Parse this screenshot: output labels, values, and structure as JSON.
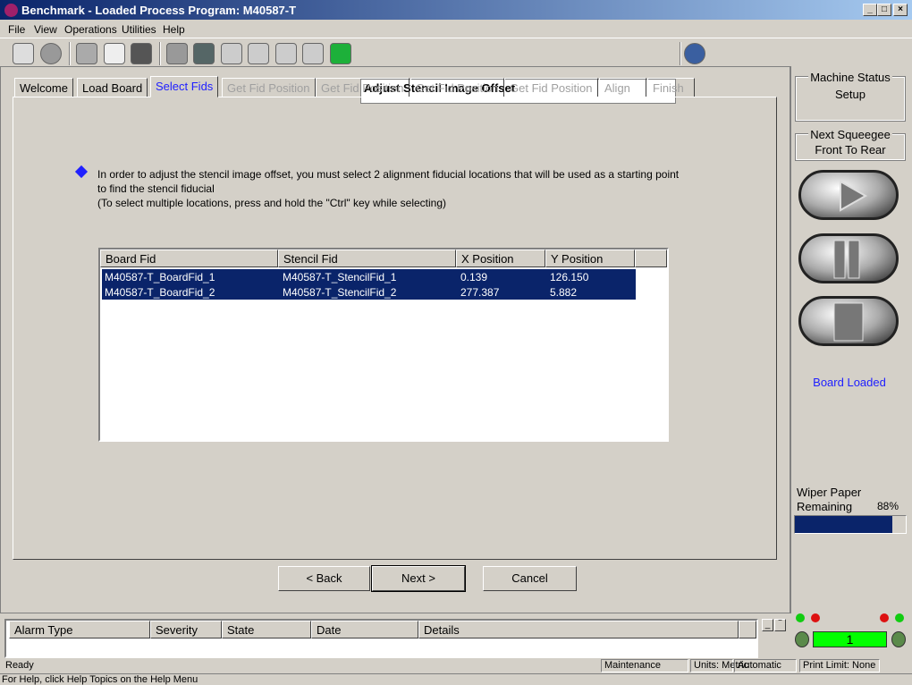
{
  "window": {
    "title": "Benchmark - Loaded Process Program:  M40587-T"
  },
  "menu": [
    "File",
    "View",
    "Operations",
    "Utilities",
    "Help"
  ],
  "toolbar": {
    "step_title": "Adjust Stencil Image Offset"
  },
  "tabs": [
    "Welcome",
    "Load Board",
    "Select Fids",
    "Get Fid Position",
    "Get Fid Position",
    "Get Fid Position",
    "Get Fid Position",
    "Align",
    "Finish"
  ],
  "instructions": {
    "line1": "In order to adjust the stencil image offset, you must select 2 alignment fiducial locations that will be used as a starting point to find the stencil fiducial",
    "line2": "(To select multiple locations, press and hold the \"Ctrl\" key while selecting)"
  },
  "fid_table": {
    "columns": [
      "Board Fid",
      "Stencil Fid",
      "X Position",
      "Y Position"
    ],
    "rows": [
      [
        "M40587-T_BoardFid_1",
        "M40587-T_StencilFid_1",
        "0.139",
        "126.150"
      ],
      [
        "M40587-T_BoardFid_2",
        "M40587-T_StencilFid_2",
        "277.387",
        "5.882"
      ]
    ]
  },
  "buttons": {
    "back": "< Back",
    "next": "Next >",
    "cancel": "Cancel"
  },
  "alarm_table": {
    "columns": [
      "Alarm Type",
      "Severity",
      "State",
      "Date",
      "Details"
    ]
  },
  "status": {
    "ready": "Ready",
    "help": "For Help, click Help Topics on the Help Menu",
    "panes": [
      "Maintenance",
      "Units: Metric",
      "Automatic",
      "Print Limit: None"
    ]
  },
  "side": {
    "machine_status_label": "Machine Status",
    "machine_status": "Setup",
    "squeegee_label": "Next Squeegee",
    "squeegee": "Front To Rear",
    "board_state": "Board Loaded",
    "wiper_label1": "Wiper Paper",
    "wiper_label2": "Remaining",
    "wiper_pct": "88%",
    "wiper_fraction": 0.88,
    "counter": "1"
  },
  "colors": {
    "selection": "#0a246a",
    "link": "#2020ff",
    "counter_bg": "#00ff00"
  }
}
